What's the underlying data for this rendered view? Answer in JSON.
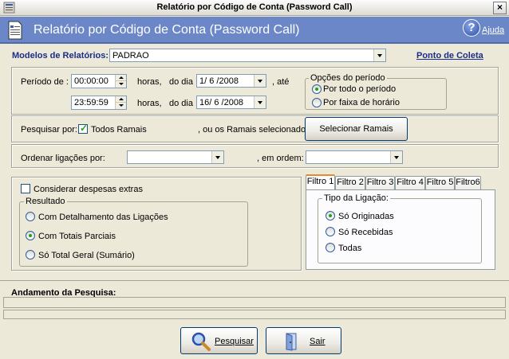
{
  "window": {
    "title": "Relatório por Código de Conta (Password Call)",
    "close_glyph": "×"
  },
  "header": {
    "title": "Relatório por Código de Conta (Password Call)",
    "help_label": "Ajuda",
    "help_glyph": "?"
  },
  "models": {
    "label": "Modelos de Relatórios:",
    "value": "PADRAO",
    "link": "Ponto de Coleta"
  },
  "period": {
    "label": "Período de :",
    "start_time": "00:00:00",
    "end_time": "23:59:59",
    "hours_label": "horas,",
    "day_label": "do dia",
    "start_date": "1/ 6 /2008",
    "end_date": "16/ 6 /2008",
    "until_label": ", até",
    "options_title": "Opções do período",
    "options": [
      "Por todo o período",
      "Por faixa de horário"
    ],
    "selected_option": 0
  },
  "search": {
    "label": "Pesquisar por:",
    "all_extensions_label": "Todos Ramais",
    "all_extensions_checked": true,
    "or_selected_label": ", ou os Ramais selecionados:",
    "select_button": "Selecionar Ramais"
  },
  "order": {
    "label": "Ordenar ligações por:",
    "value": "",
    "order_label": ", em ordem:",
    "order_value": ""
  },
  "extras": {
    "label": "Considerar  despesas  extras",
    "checked": false
  },
  "result": {
    "title": "Resultado",
    "options": [
      "Com Detalhamento das Ligações",
      "Com Totais  Parciais",
      "Só Total  Geral (Sumário)"
    ],
    "selected": 1
  },
  "filters": {
    "tabs": [
      "Filtro 1",
      "Filtro 2",
      "Filtro 3",
      "Filtro 4",
      "Filtro 5",
      "Filtro6"
    ],
    "active_tab": 0,
    "group_title": "Tipo da Ligação:",
    "options": [
      "Só Originadas",
      "Só Recebidas",
      "Todas"
    ],
    "selected": 0
  },
  "progress": {
    "label": "Andamento da Pesquisa:",
    "fraction": 0
  },
  "buttons": {
    "search": "Pesquisar",
    "exit": "Sair"
  },
  "colors": {
    "header_bg": "#6b87c8",
    "label_blue": "#1a2c8c"
  }
}
